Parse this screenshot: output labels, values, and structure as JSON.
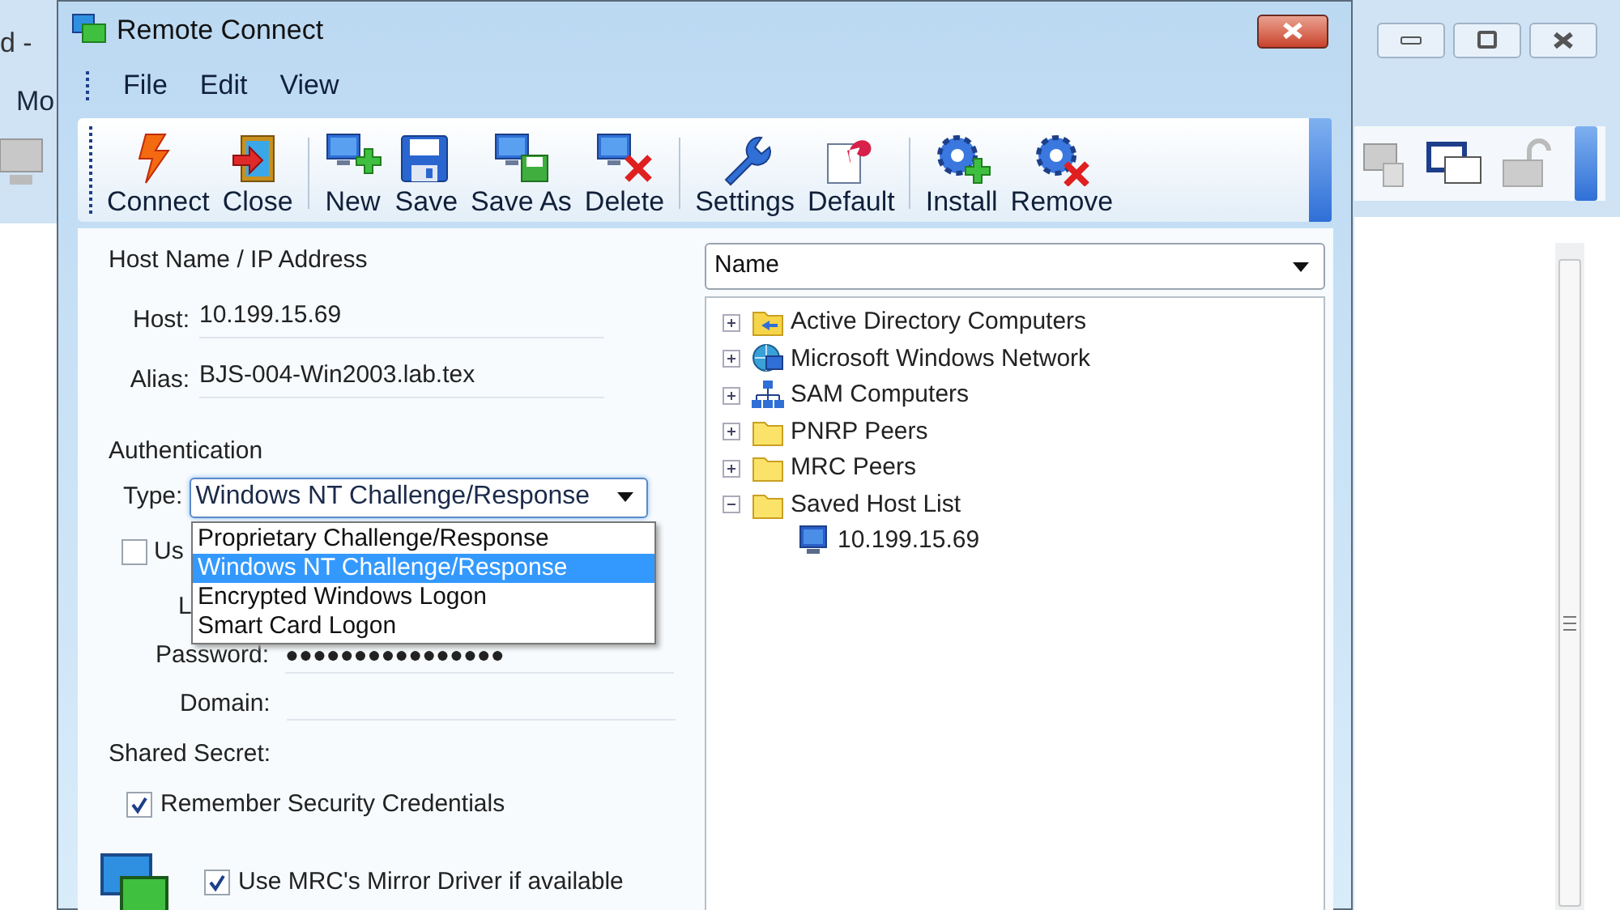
{
  "background_window": {
    "title_fragment": "d - ",
    "menu_fragment": "Mo"
  },
  "window": {
    "title": "Remote Connect"
  },
  "menu": [
    "File",
    "Edit",
    "View"
  ],
  "toolbar_groups": [
    [
      {
        "label": "Connect"
      },
      {
        "label": "Close"
      }
    ],
    [
      {
        "label": "New"
      },
      {
        "label": "Save"
      },
      {
        "label": "Save As"
      },
      {
        "label": "Delete"
      }
    ],
    [
      {
        "label": "Settings"
      },
      {
        "label": "Default"
      }
    ],
    [
      {
        "label": "Install"
      },
      {
        "label": "Remove"
      }
    ]
  ],
  "host": {
    "heading": "Host Name / IP Address",
    "fields": [
      {
        "label": "Host:",
        "value": "10.199.15.69"
      },
      {
        "label": "Alias:",
        "value": "BJS-004-Win2003.lab.tex"
      }
    ]
  },
  "authentication": {
    "heading": "Authentication",
    "type_label": "Type:",
    "type_value": "Windows NT Challenge/Response",
    "options": [
      {
        "label": "Proprietary Challenge/Response",
        "selected": false
      },
      {
        "label": "Windows NT Challenge/Response",
        "selected": true
      },
      {
        "label": "Encrypted Windows Logon",
        "selected": false
      },
      {
        "label": "Smart Card Logon",
        "selected": false
      }
    ],
    "covered_checkbox": {
      "label": "Us",
      "checked": false
    },
    "covered_label": "L",
    "password_label": "Password:",
    "password_value": "●●●●●●●●●●●●●●●●",
    "domain_label": "Domain:",
    "shared_secret_label": "Shared Secret:",
    "remember": {
      "label": "Remember Security Credentials",
      "checked": true
    }
  },
  "display": {
    "mirror": {
      "label": "Use MRC's Mirror Driver if available",
      "checked": true
    }
  },
  "sort": {
    "value": "Name"
  },
  "tree": [
    {
      "label": "Active Directory Computers",
      "expanded": false
    },
    {
      "label": "Microsoft Windows Network",
      "expanded": false
    },
    {
      "label": "SAM Computers",
      "expanded": false
    },
    {
      "label": "PNRP Peers",
      "expanded": false
    },
    {
      "label": "MRC Peers",
      "expanded": false
    },
    {
      "label": "Saved Host List",
      "expanded": true,
      "children": [
        {
          "label": "10.199.15.69"
        }
      ]
    }
  ]
}
